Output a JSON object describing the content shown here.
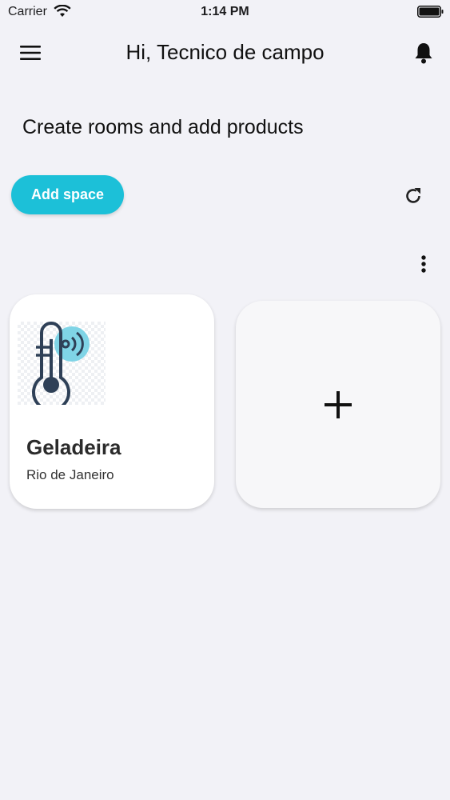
{
  "status_bar": {
    "carrier": "Carrier",
    "time": "1:14 PM"
  },
  "header": {
    "title": "Hi, Tecnico de campo"
  },
  "subtitle": "Create rooms and add products",
  "actions": {
    "add_space_label": "Add space"
  },
  "rooms": [
    {
      "name": "Geladeira",
      "location": "Rio de Janeiro",
      "icon": "thermometer-wireless-icon"
    }
  ],
  "colors": {
    "accent": "#1cc0d8",
    "icon_dark": "#2e4057",
    "icon_light": "#7fd4e6",
    "background": "#f2f2f7"
  },
  "icons": [
    "hamburger-menu-icon",
    "bell-icon",
    "refresh-icon",
    "more-vertical-icon",
    "plus-icon",
    "wifi-icon",
    "battery-icon"
  ]
}
